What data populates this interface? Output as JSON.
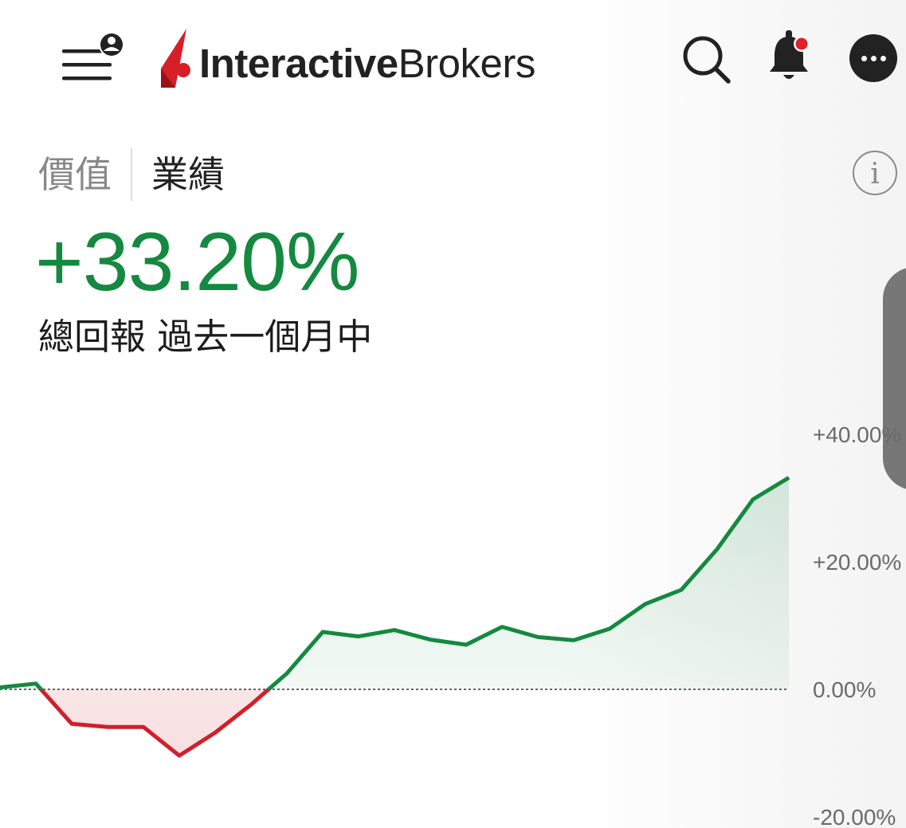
{
  "header": {
    "menu_icon": "menu-with-account-icon",
    "logo_bold": "Interactive",
    "logo_regular": "Brokers",
    "search_icon": "search-icon",
    "bell_icon": "bell-icon",
    "more_icon": "more-horizontal-icon"
  },
  "tabs": [
    {
      "label": "價值",
      "active": false
    },
    {
      "label": "業績",
      "active": true
    }
  ],
  "info_label": "i",
  "performance": {
    "value": "+33.20%",
    "subtitle": "總回報 過去一個月中"
  },
  "colors": {
    "positive": "#14893f",
    "negative": "#d0202b",
    "brand_red": "#d71f28"
  },
  "chart_data": {
    "type": "area",
    "y_ticks": [
      "+40.00%",
      "+20.00%",
      "0.00%",
      "-20.00%"
    ],
    "ylim": [
      -20,
      40
    ],
    "baseline": 0,
    "values": [
      0.3,
      0.9,
      -5.4,
      -5.9,
      -5.9,
      -10.4,
      -6.8,
      -2.4,
      2.5,
      9.0,
      8.3,
      9.3,
      7.8,
      7.0,
      9.8,
      8.2,
      7.7,
      9.5,
      13.4,
      15.6,
      22.0,
      29.8,
      33.2
    ]
  }
}
